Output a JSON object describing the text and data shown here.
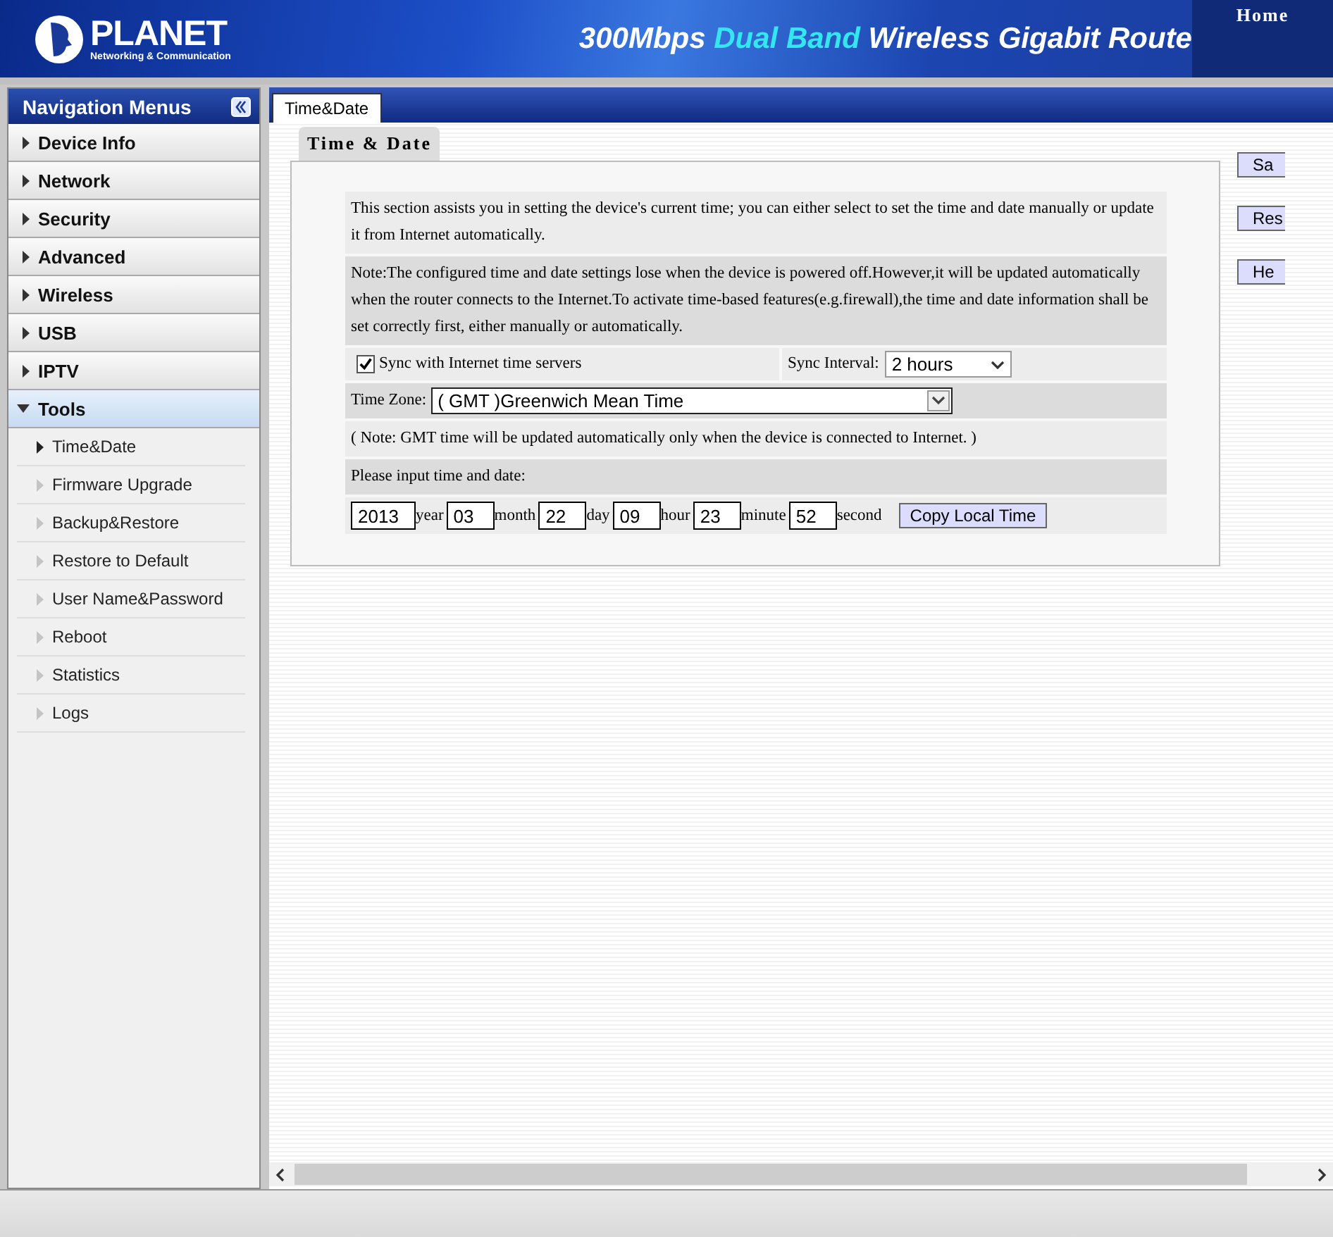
{
  "header": {
    "logo_name": "PLANET",
    "logo_tagline": "Networking & Communication",
    "title_parts": [
      {
        "text": "300Mbps ",
        "kind": "plain"
      },
      {
        "text": "Dual Band",
        "kind": "highlight"
      },
      {
        "text": " Wireless Gigabit Route",
        "kind": "plain"
      }
    ],
    "home_link": "Home"
  },
  "sidebar": {
    "title": "Navigation Menus",
    "menus": [
      {
        "label": "Device Info",
        "expanded": false
      },
      {
        "label": "Network",
        "expanded": false
      },
      {
        "label": "Security",
        "expanded": false
      },
      {
        "label": "Advanced",
        "expanded": false
      },
      {
        "label": "Wireless",
        "expanded": false
      },
      {
        "label": "USB",
        "expanded": false
      },
      {
        "label": "IPTV",
        "expanded": false
      },
      {
        "label": "Tools",
        "expanded": true,
        "children": [
          {
            "label": "Time&Date",
            "selected": true
          },
          {
            "label": "Firmware Upgrade",
            "selected": false
          },
          {
            "label": "Backup&Restore",
            "selected": false
          },
          {
            "label": "Restore to Default",
            "selected": false
          },
          {
            "label": "User Name&Password",
            "selected": false
          },
          {
            "label": "Reboot",
            "selected": false
          },
          {
            "label": "Statistics",
            "selected": false
          },
          {
            "label": "Logs",
            "selected": false
          }
        ]
      }
    ]
  },
  "tabs": [
    {
      "label": "Time&Date",
      "selected": true
    }
  ],
  "section_title": "Time & Date",
  "intro": "This section assists you in setting the device's current time; you can either select to set the time and date manually or update it from Internet automatically.",
  "note": "Note:The configured time and date settings lose when the device is powered off.However,it will be updated automatically when the router connects to the Internet.To activate time-based features(e.g.firewall),the time and date information shall be set correctly first, either manually or automatically.",
  "sync": {
    "label": "Sync with Internet time servers",
    "checked": true
  },
  "sync_interval": {
    "label": "Sync Interval:",
    "value": "2 hours"
  },
  "time_zone": {
    "label": "Time Zone:",
    "value": "( GMT )Greenwich Mean Time"
  },
  "gmt_note": "( Note: GMT time will be updated automatically only when the device is connected to Internet. )",
  "input_prompt": "Please input time and date:",
  "datetime": [
    {
      "value": "2013",
      "unit": "year"
    },
    {
      "value": "03",
      "unit": "month"
    },
    {
      "value": "22",
      "unit": "day"
    },
    {
      "value": "09",
      "unit": "hour"
    },
    {
      "value": "23",
      "unit": "minute"
    },
    {
      "value": "52",
      "unit": "second"
    }
  ],
  "copy_button": "Copy Local Time",
  "side_buttons": [
    "Sa",
    "Res",
    "He"
  ]
}
